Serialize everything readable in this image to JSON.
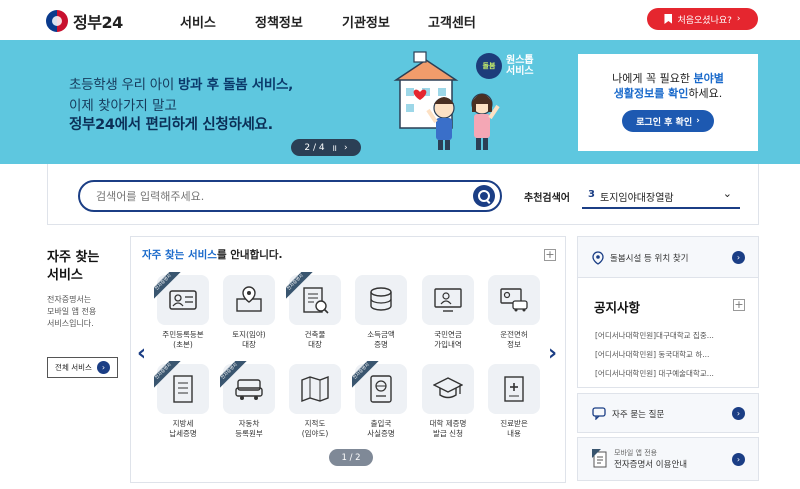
{
  "header": {
    "logo_text": "정부24",
    "nav": [
      "서비스",
      "정책정보",
      "기관정보",
      "고객센터"
    ],
    "first_visit_label": "처음오셨나요?"
  },
  "banner": {
    "line1_a": "초등학생 우리 아이 ",
    "line1_b": "방과 후 돌봄 서비스,",
    "line2": "이제 찾아가지 말고",
    "line3": "정부24에서 편리하게 신청하세요.",
    "pager": "2 / 4",
    "pager_pause": "॥",
    "pager_next": "›",
    "badge_text": "돌봄",
    "badge_label_1": "원스톱",
    "badge_label_2": "서비스"
  },
  "login_box": {
    "line1_a": "나에게 꼭 필요한 ",
    "line1_b": "분야별",
    "line2_a": "생활정보를 확인",
    "line2_b": "하세요.",
    "button_label": "로그인 후 확인"
  },
  "search": {
    "placeholder": "검색어를 입력해주세요.",
    "rec_label": "추천검색어",
    "rec_number": "3",
    "rec_value": "토지임야대장열람"
  },
  "left_col": {
    "heading_1": "자주 찾는",
    "heading_2": "서비스",
    "desc_1": "전자증명서는",
    "desc_2": "모바일 앱 전용",
    "desc_3": "서비스입니다.",
    "all_button": "전체 서비스"
  },
  "services": {
    "title_a": "자주 찾는 서비스",
    "title_b": "를 안내합니다.",
    "ribbon_text": "전자증명서",
    "items": [
      {
        "line1": "주민등록등본",
        "line2": "(초본)",
        "icon": "id-card-icon",
        "ribbon": true
      },
      {
        "line1": "토지(임야)",
        "line2": "대장",
        "icon": "map-pin-doc-icon",
        "ribbon": false
      },
      {
        "line1": "건축물",
        "line2": "대장",
        "icon": "building-doc-icon",
        "ribbon": true
      },
      {
        "line1": "소득금액",
        "line2": "증명",
        "icon": "coin-stack-icon",
        "ribbon": false
      },
      {
        "line1": "국민연금",
        "line2": "가입내역",
        "icon": "monitor-person-icon",
        "ribbon": false
      },
      {
        "line1": "운전면허",
        "line2": "정보",
        "icon": "license-car-icon",
        "ribbon": false
      },
      {
        "line1": "지방세",
        "line2": "납세증명",
        "icon": "tax-doc-icon",
        "ribbon": true
      },
      {
        "line1": "자동차",
        "line2": "등록원부",
        "icon": "car-icon",
        "ribbon": true
      },
      {
        "line1": "지적도",
        "line2": "(임야도)",
        "icon": "folded-map-icon",
        "ribbon": false
      },
      {
        "line1": "출입국",
        "line2": "사실증명",
        "icon": "passport-icon",
        "ribbon": true
      },
      {
        "line1": "대학 제증명",
        "line2": "발급 신청",
        "icon": "graduation-cap-icon",
        "ribbon": false
      },
      {
        "line1": "진료받은",
        "line2": "내용",
        "icon": "medical-doc-icon",
        "ribbon": false
      }
    ],
    "page": "1 / 2"
  },
  "right_col": {
    "care_facility": "돌봄시설 등 위치 찾기",
    "notice_title": "공지사항",
    "notices": [
      "[어디서나대학민원]대구대학교 집중...",
      "[어디서나대학민원] 동국대학교 하...",
      "[어디서나대학민원] 대구예술대학교..."
    ],
    "faq": "자주 묻는 질문",
    "mobile_1": "모바일 앱 전용",
    "mobile_2": "전자증명서 이용안내"
  }
}
